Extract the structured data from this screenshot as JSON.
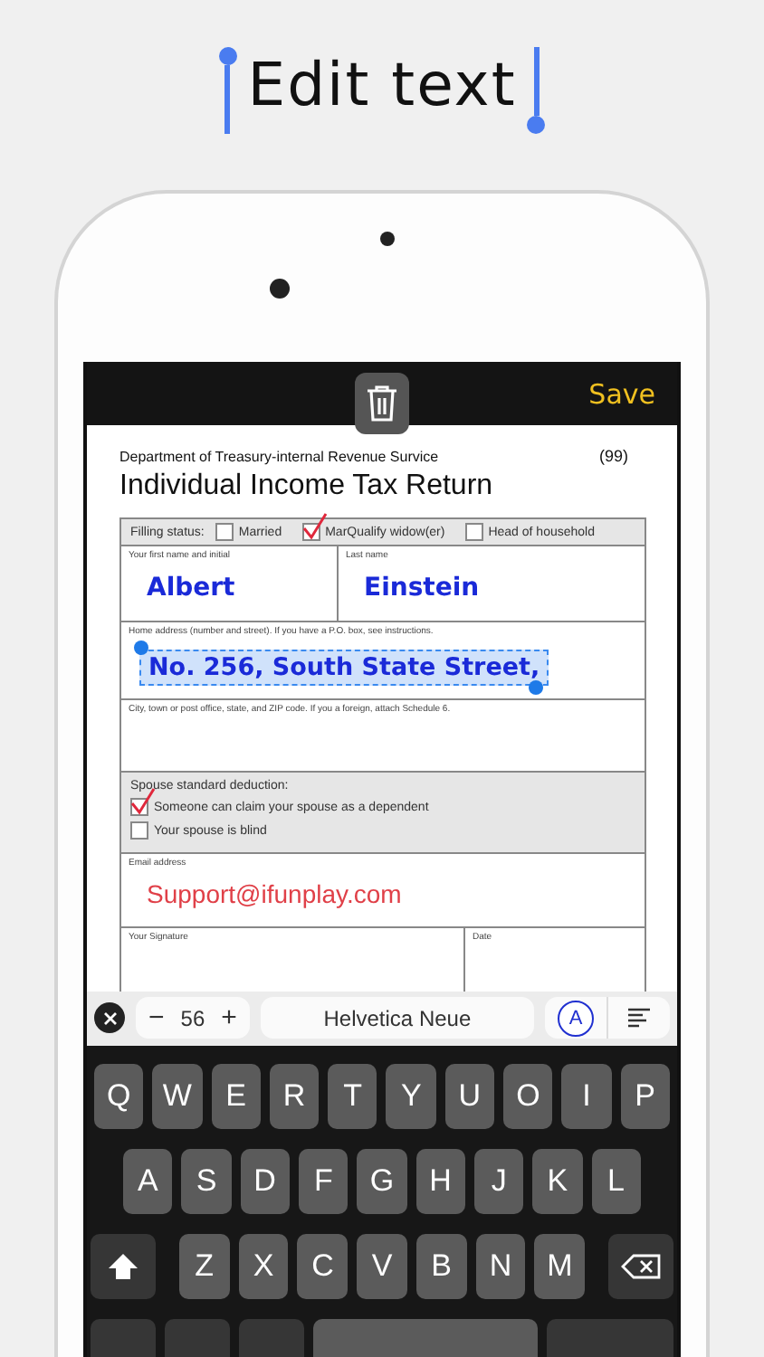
{
  "header": {
    "title": "Edit text"
  },
  "top_bar": {
    "save": "Save"
  },
  "document": {
    "department": "Department of Treasury-internal Revenue Survice",
    "code": "(99)",
    "title": "Individual Income Tax Return",
    "filing_status": {
      "label": "Filling status:",
      "options": [
        {
          "label": "Married",
          "checked": false
        },
        {
          "label": "MarQualify widow(er)",
          "checked": true
        },
        {
          "label": "Head of household",
          "checked": false
        }
      ]
    },
    "first_name": {
      "label": "Your first name and initial",
      "value": "Albert"
    },
    "last_name": {
      "label": "Last name",
      "value": "Einstein"
    },
    "home_address": {
      "label": "Home address (number and street). If you have a P.O. box, see instructions.",
      "value": "No. 256, South State Street,",
      "selected": true
    },
    "city": {
      "label": "City, town or post office, state, and ZIP code. If you a foreign, attach Schedule 6."
    },
    "spouse": {
      "label": "Spouse standard deduction:",
      "options": [
        {
          "label": "Someone can claim your spouse as a dependent",
          "checked": true
        },
        {
          "label": "Your spouse is blind",
          "checked": false
        }
      ]
    },
    "email": {
      "label": "Email address",
      "value": "Support@ifunplay.com"
    },
    "signature": {
      "label": "Your Signature"
    },
    "date": {
      "label": "Date"
    }
  },
  "toolbar": {
    "minus": "−",
    "font_size": "56",
    "plus": "+",
    "font_name": "Helvetica Neue",
    "color_button": "A"
  },
  "keyboard": {
    "rows": [
      [
        "Q",
        "W",
        "E",
        "R",
        "T",
        "Y",
        "U",
        "O",
        "I",
        "P"
      ],
      [
        "A",
        "S",
        "D",
        "F",
        "G",
        "H",
        "J",
        "K",
        "L"
      ],
      [
        "Z",
        "X",
        "C",
        "V",
        "B",
        "N",
        "M"
      ]
    ]
  }
}
